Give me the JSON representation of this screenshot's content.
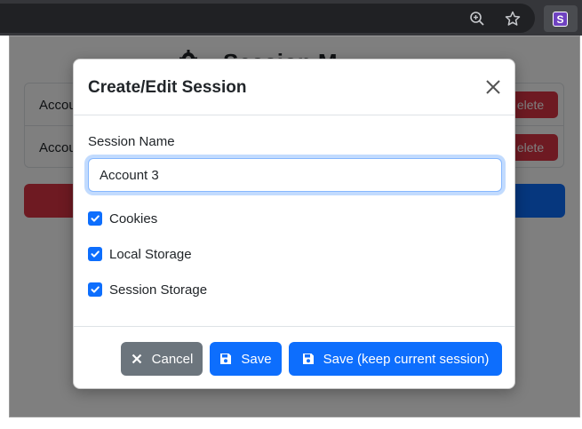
{
  "modal": {
    "title": "Create/Edit Session",
    "session_name_label": "Session Name",
    "session_name_value": "Account 3",
    "checkboxes": [
      {
        "label": "Cookies",
        "checked": true
      },
      {
        "label": "Local Storage",
        "checked": true
      },
      {
        "label": "Session Storage",
        "checked": true
      }
    ],
    "buttons": {
      "cancel": "Cancel",
      "save": "Save",
      "save_keep": "Save (keep current session)"
    }
  },
  "background": {
    "title_partial": "Session M",
    "rows": [
      {
        "label": "Accou",
        "delete": "elete"
      },
      {
        "label": "Accou",
        "delete": "elete"
      }
    ]
  },
  "browser": {
    "extension_letter": "S"
  },
  "colors": {
    "primary": "#0d6efd",
    "secondary": "#6c757d",
    "danger": "#dc3545"
  }
}
